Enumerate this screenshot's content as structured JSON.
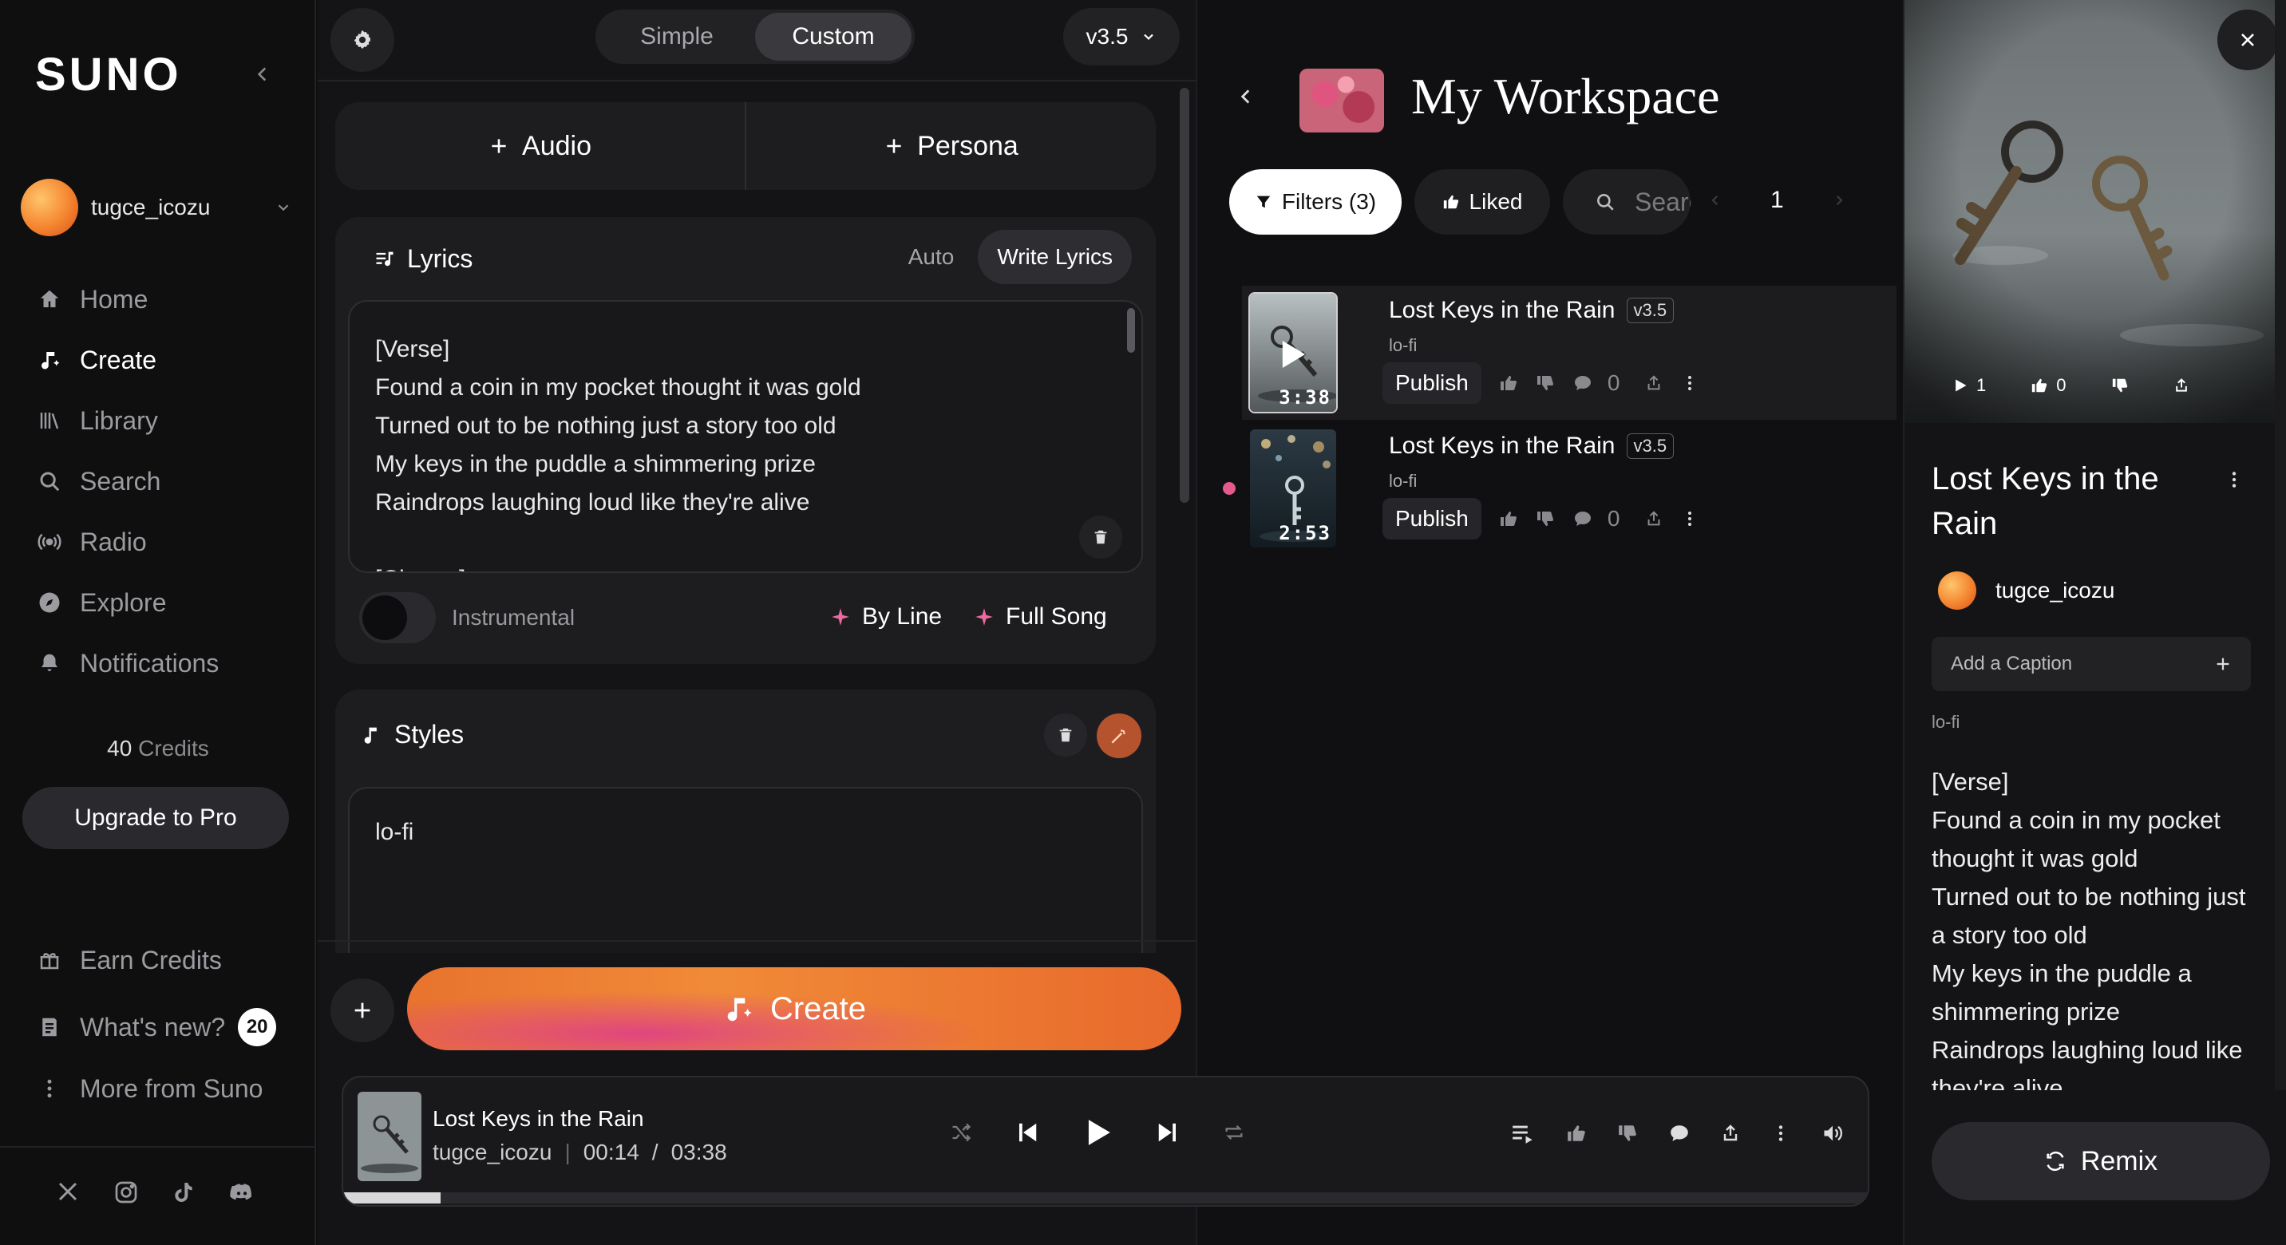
{
  "sidebar": {
    "logo": "SUNO",
    "user": "tugce_icozu",
    "nav": [
      {
        "label": "Home",
        "icon": "home-icon"
      },
      {
        "label": "Create",
        "icon": "create-icon"
      },
      {
        "label": "Library",
        "icon": "library-icon"
      },
      {
        "label": "Search",
        "icon": "search-icon"
      },
      {
        "label": "Radio",
        "icon": "radio-icon"
      },
      {
        "label": "Explore",
        "icon": "explore-icon"
      },
      {
        "label": "Notifications",
        "icon": "bell-icon"
      }
    ],
    "active_nav": "Create",
    "credits_value": "40",
    "credits_label": "Credits",
    "upgrade_label": "Upgrade to Pro",
    "earn_credits": "Earn Credits",
    "whats_new": "What's new?",
    "whats_new_count": "20",
    "more_from": "More from Suno",
    "social": [
      "x-icon",
      "instagram-icon",
      "tiktok-icon",
      "discord-icon"
    ]
  },
  "create": {
    "mode_tabs": [
      "Simple",
      "Custom"
    ],
    "active_mode": "Custom",
    "model_version": "v3.5",
    "add_audio": "Audio",
    "add_persona": "Persona",
    "lyrics_title": "Lyrics",
    "lyrics_tab_auto": "Auto",
    "lyrics_tab_write": "Write Lyrics",
    "lyrics_text": "[Verse]\nFound a coin in my pocket thought it was gold\nTurned out to be nothing just a story too old\nMy keys in the puddle a shimmering prize\nRaindrops laughing loud like they're alive\n\n[Chorus]",
    "instrumental_label": "Instrumental",
    "instrumental_on": false,
    "by_line": "By Line",
    "full_song": "Full Song",
    "styles_title": "Styles",
    "styles_text": "lo-fi",
    "create_label": "Create"
  },
  "workspace": {
    "title": "My Workspace",
    "filters_label": "Filters (3)",
    "liked_label": "Liked",
    "search_placeholder": "Search",
    "page": "1",
    "songs": [
      {
        "title": "Lost Keys in the Rain",
        "version": "v3.5",
        "genre": "lo-fi",
        "duration": "3:38",
        "publish": "Publish",
        "comments": "0",
        "selected": true
      },
      {
        "title": "Lost Keys in the Rain",
        "version": "v3.5",
        "genre": "lo-fi",
        "duration": "2:53",
        "publish": "Publish",
        "comments": "0",
        "selected": false
      }
    ]
  },
  "detail": {
    "play_count": "1",
    "like_count": "0",
    "title": "Lost Keys in the Rain",
    "user": "tugce_icozu",
    "caption_placeholder": "Add a Caption",
    "genre": "lo-fi",
    "lyrics": "[Verse]\nFound a coin in my pocket thought it was gold\nTurned out to be nothing just a story too old\nMy keys in the puddle a shimmering prize\nRaindrops laughing loud like they're alive",
    "remix_label": "Remix"
  },
  "player": {
    "title": "Lost Keys in the Rain",
    "artist": "tugce_icozu",
    "current_time": "00:14",
    "time_sep": "/",
    "total_time": "03:38",
    "progress": 0.064
  }
}
